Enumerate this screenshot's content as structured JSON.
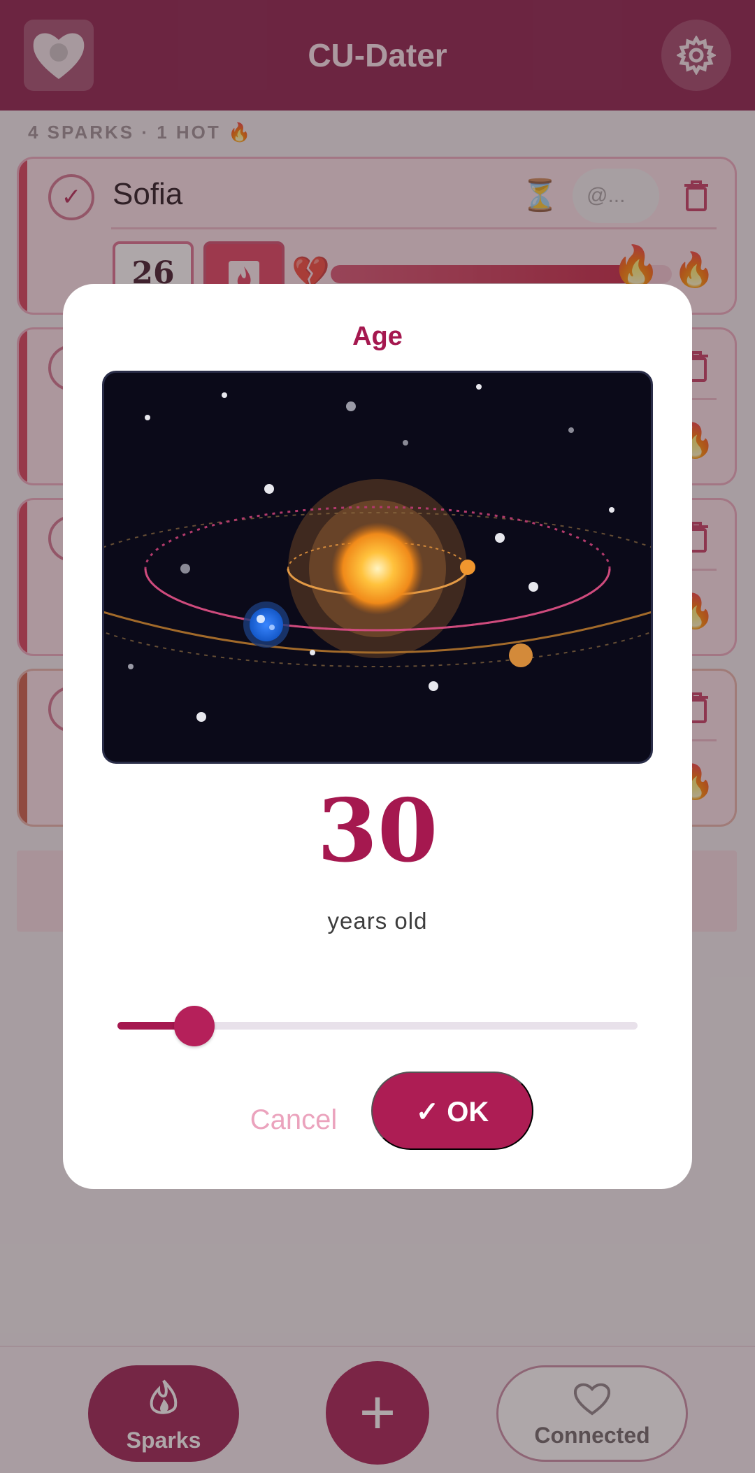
{
  "header": {
    "title": "CU-Dater"
  },
  "summary": {
    "sparks": "4 SPARKS",
    "hot": "· 1 HOT",
    "hot_icon": "🔥"
  },
  "cards": [
    {
      "name": "Sofia",
      "status_icon": "⏳",
      "handle_placeholder": "@...",
      "age": "26",
      "heat_icon_left": "💔",
      "heat_level": 0.9,
      "flame": "🔥",
      "flame_right": "🔥"
    },
    {
      "flame_right": "🔥"
    },
    {
      "flame_right": "🔥"
    },
    {
      "flame_right": "🔥"
    }
  ],
  "dialog": {
    "title": "Age",
    "value": "30",
    "unit": "years old",
    "slider": {
      "min": 18,
      "max": 99,
      "value": 30
    },
    "cancel_label": "Cancel",
    "ok_label": "✓ OK"
  },
  "nav": {
    "sparks_label": "Sparks",
    "add_label": "+",
    "connected_label": "Connected"
  },
  "colors": {
    "brand": "#8a1846",
    "accent": "#a5184f"
  },
  "icons": {
    "logo": "heart-logo-icon",
    "settings": "gear-icon",
    "sparks": "flame-icon",
    "connected": "heart-outline-icon"
  }
}
